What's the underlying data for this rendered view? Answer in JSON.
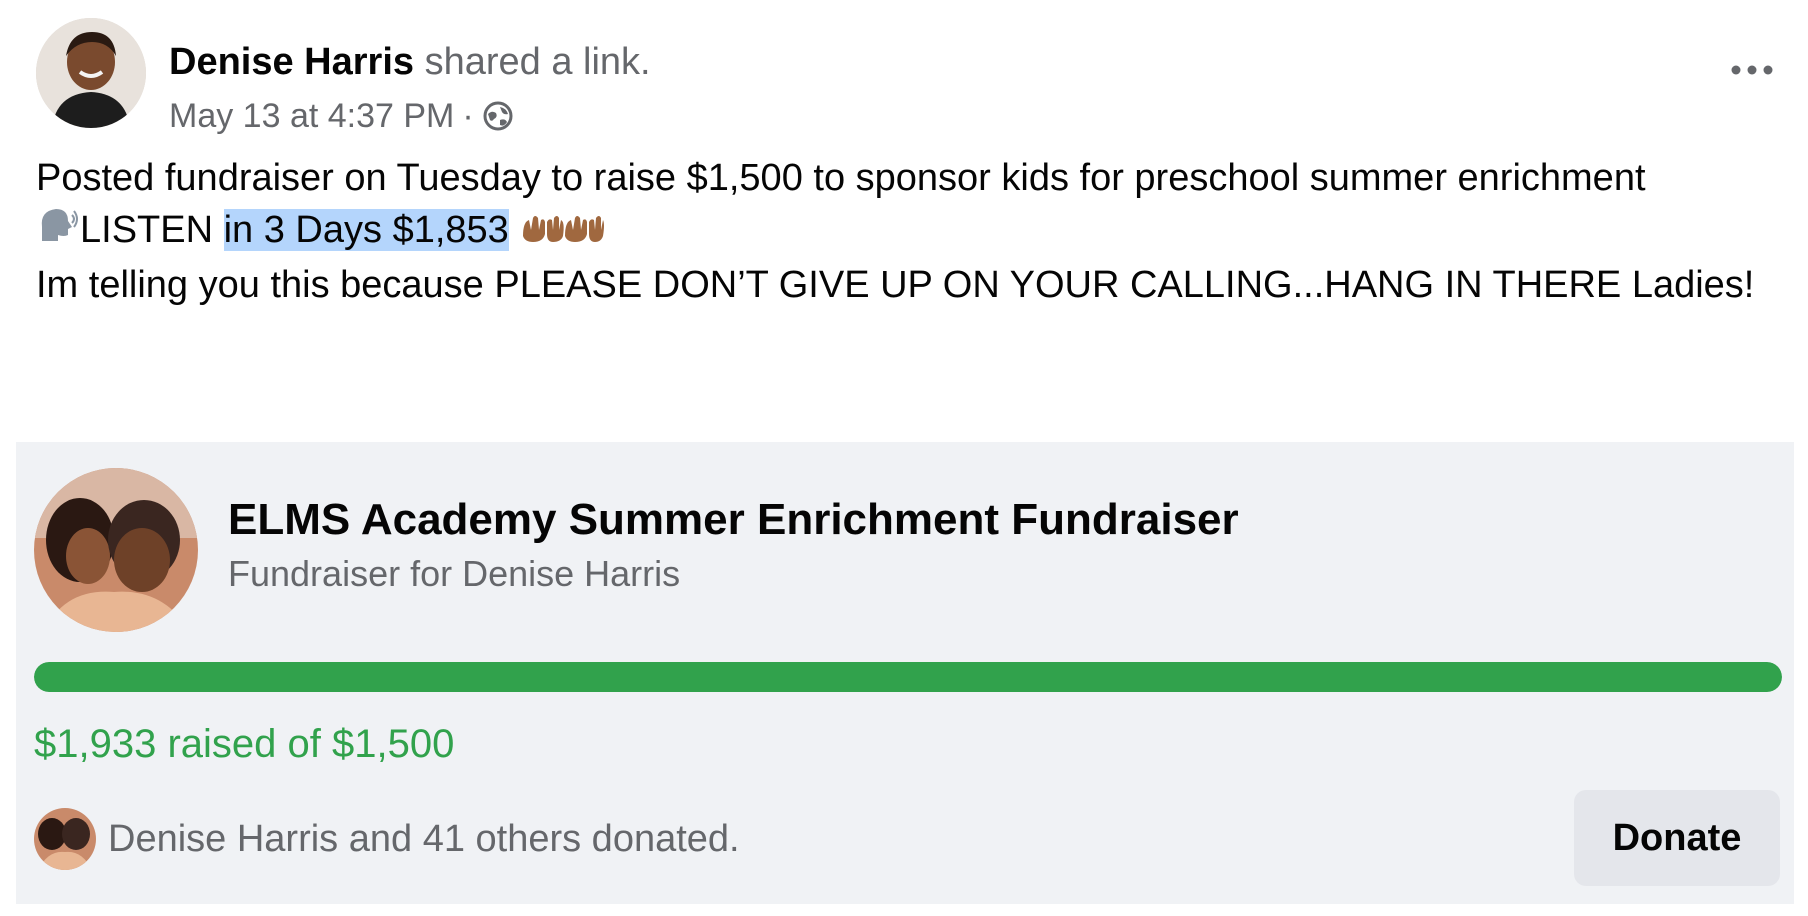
{
  "post": {
    "author": "Denise Harris",
    "action": "shared a link.",
    "timestamp": "May 13 at 4:37 PM",
    "separator": "·",
    "privacy_icon": "public-globe-icon",
    "more_icon": "more-options-icon",
    "text_line1": "Posted fundraiser on Tuesday to raise $1,500 to sponsor kids for preschool summer enrichment",
    "listen_prefix": "LISTEN ",
    "listen_highlight": "in 3 Days $1,853",
    "speaking_icon": "speaking-head-icon",
    "raised_hands_icon": "raising-hands-icon",
    "text_line3": "Im telling you this because PLEASE DON’T GIVE UP ON YOUR CALLING...HANG IN THERE Ladies!"
  },
  "fundraiser": {
    "title": "ELMS Academy Summer Enrichment Fundraiser",
    "subtitle": "Fundraiser for Denise Harris",
    "raised_text": "$1,933 raised of $1,500",
    "progress_fraction": 1.0,
    "donors_text": "Denise Harris and 41 others donated.",
    "donate_label": "Donate"
  },
  "colors": {
    "progress_green": "#31a24c",
    "highlight": "#b4d5fc",
    "card_bg": "#f0f2f5",
    "secondary_text": "#65676b"
  }
}
